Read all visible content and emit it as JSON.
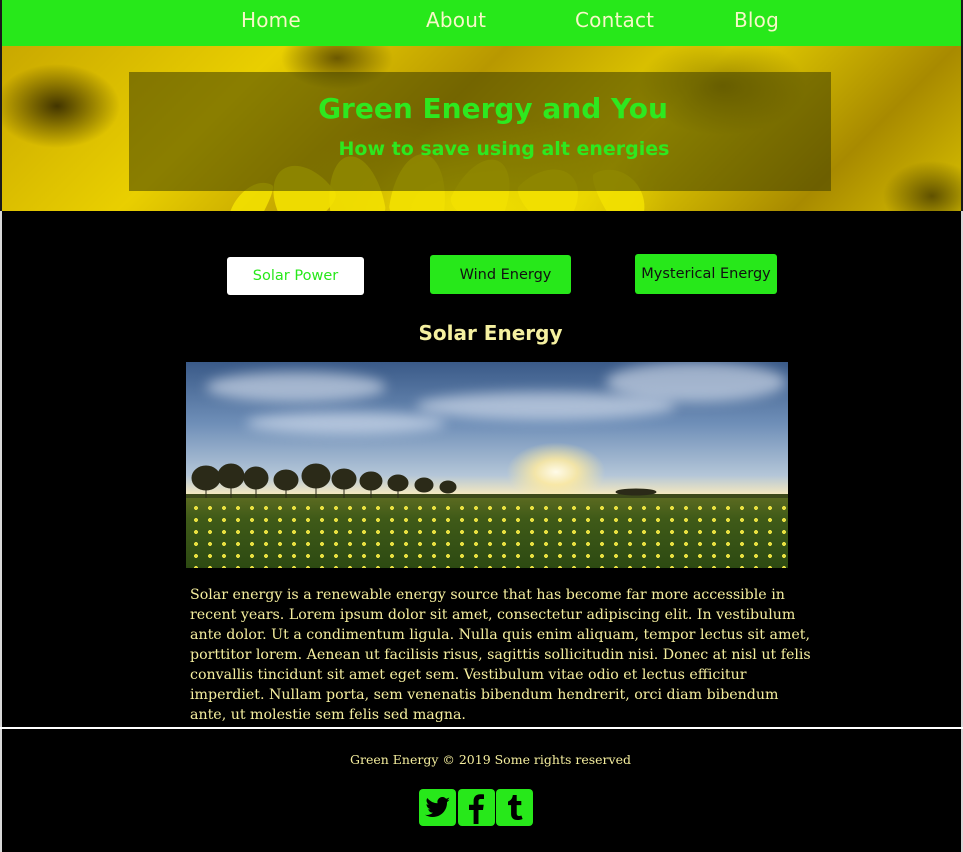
{
  "nav": {
    "items": [
      {
        "label": "Home"
      },
      {
        "label": "About"
      },
      {
        "label": "Contact"
      },
      {
        "label": "Blog"
      }
    ]
  },
  "hero": {
    "title": "Green Energy and You",
    "subtitle": "How to save using alt energies"
  },
  "tabs": [
    {
      "label": "Solar Power",
      "active": true
    },
    {
      "label": "Wind Energy",
      "active": false
    },
    {
      "label": "Mysterical Energy",
      "active": false
    }
  ],
  "section": {
    "title": "Solar Energy",
    "image_icon": "landscape-photo",
    "body": "Solar energy is a renewable energy source that has become far more accessible in recent years. Lorem ipsum dolor sit amet, consectetur adipiscing elit. In vestibulum ante dolor. Ut a condimentum ligula. Nulla quis enim aliquam, tempor lectus sit amet, porttitor lorem. Aenean ut facilisis risus, sagittis sollicitudin nisi. Donec at nisl ut felis convallis tincidunt sit amet eget sem. Vestibulum vitae odio et lectus efficitur imperdiet. Nullam porta, sem venenatis bibendum hendrerit, orci diam bibendum ante, ut molestie sem felis sed magna."
  },
  "footer": {
    "text": "Green Energy © 2019 Some rights reserved",
    "social": [
      {
        "icon": "twitter-icon"
      },
      {
        "icon": "facebook-icon"
      },
      {
        "icon": "tumblr-icon"
      }
    ]
  },
  "colors": {
    "accent": "#27e81a",
    "text_yellow": "#f5ee9e",
    "background": "#000000"
  }
}
